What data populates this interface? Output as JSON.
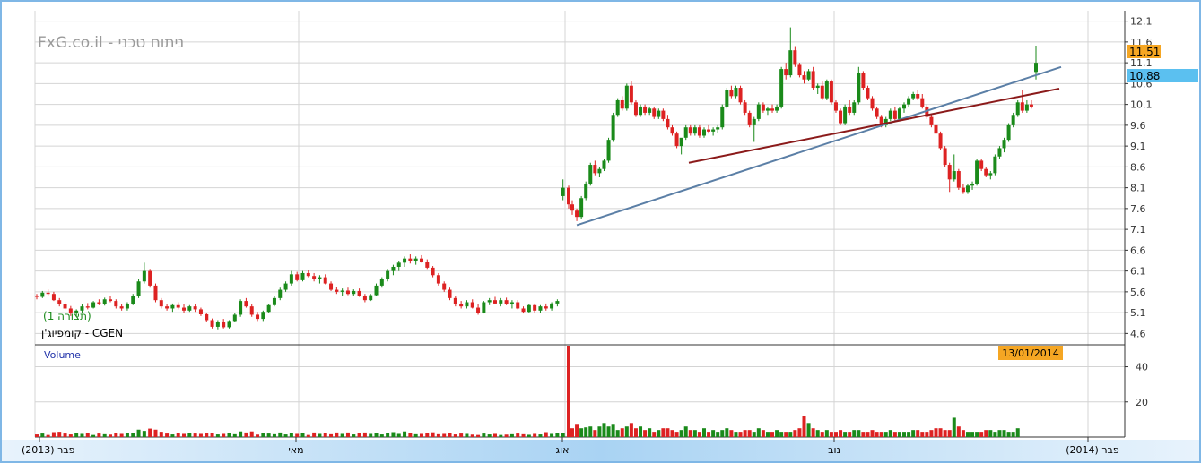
{
  "watermark": "FxG.co.il - ניתוח טכני",
  "instrument": "קומפיוג'ן - CGEN",
  "view_label": "(תצורה 1)",
  "volume_label": "Volume",
  "date_badge": "13/01/2014",
  "colors": {
    "up": "#1a8a1a",
    "down": "#dd2222",
    "trend_blue": "#5b7fa6",
    "trend_red": "#8b1a1a",
    "last_price_badge": "#f5a623",
    "prev_price_badge": "#5bc0f0",
    "date_badge": "#f5a623",
    "frame": "#7fb7e6",
    "grid": "#d4d4d4"
  },
  "chart_data": {
    "type": "candlestick",
    "price_axis": {
      "ticks": [
        "12.1",
        "11.6",
        "11.1",
        "10.6",
        "10.1",
        "9.6",
        "9.1",
        "8.6",
        "8.1",
        "7.6",
        "7.1",
        "6.6",
        "6.1",
        "5.6",
        "5.1",
        "4.6"
      ],
      "range": [
        4.35,
        12.35
      ],
      "last_price": "11.51",
      "prev_price": "10.88"
    },
    "volume_axis": {
      "ticks": [
        "40",
        "20"
      ],
      "max": 52
    },
    "x_axis": {
      "labels": [
        "(2013) פבר",
        "מאי",
        "אוג",
        "נוב",
        "(2014) פבר"
      ]
    },
    "candles": [
      [
        5.5,
        5.55,
        5.42,
        5.48
      ],
      [
        5.48,
        5.62,
        5.45,
        5.58
      ],
      [
        5.58,
        5.66,
        5.5,
        5.55
      ],
      [
        5.55,
        5.6,
        5.38,
        5.4
      ],
      [
        5.4,
        5.45,
        5.25,
        5.3
      ],
      [
        5.3,
        5.36,
        5.16,
        5.2
      ],
      [
        5.2,
        5.26,
        5.02,
        5.08
      ],
      [
        5.08,
        5.18,
        5.0,
        5.15
      ],
      [
        5.15,
        5.3,
        5.1,
        5.25
      ],
      [
        5.25,
        5.33,
        5.18,
        5.22
      ],
      [
        5.22,
        5.38,
        5.2,
        5.35
      ],
      [
        5.35,
        5.42,
        5.28,
        5.3
      ],
      [
        5.3,
        5.46,
        5.27,
        5.42
      ],
      [
        5.42,
        5.5,
        5.35,
        5.38
      ],
      [
        5.38,
        5.42,
        5.2,
        5.25
      ],
      [
        5.25,
        5.3,
        5.15,
        5.2
      ],
      [
        5.2,
        5.35,
        5.15,
        5.3
      ],
      [
        5.3,
        5.55,
        5.28,
        5.5
      ],
      [
        5.5,
        5.9,
        5.45,
        5.85
      ],
      [
        5.85,
        6.3,
        5.8,
        6.1
      ],
      [
        6.1,
        6.15,
        5.7,
        5.75
      ],
      [
        5.75,
        5.8,
        5.35,
        5.4
      ],
      [
        5.4,
        5.45,
        5.2,
        5.25
      ],
      [
        5.25,
        5.3,
        5.15,
        5.2
      ],
      [
        5.2,
        5.32,
        5.12,
        5.28
      ],
      [
        5.28,
        5.35,
        5.18,
        5.22
      ],
      [
        5.22,
        5.3,
        5.1,
        5.15
      ],
      [
        5.15,
        5.28,
        5.12,
        5.25
      ],
      [
        5.25,
        5.3,
        5.12,
        5.18
      ],
      [
        5.18,
        5.22,
        5.02,
        5.06
      ],
      [
        5.06,
        5.1,
        4.88,
        4.92
      ],
      [
        4.92,
        4.96,
        4.72,
        4.76
      ],
      [
        4.76,
        4.92,
        4.7,
        4.88
      ],
      [
        4.88,
        4.95,
        4.72,
        4.75
      ],
      [
        4.75,
        4.92,
        4.72,
        4.9
      ],
      [
        4.9,
        5.1,
        4.88,
        5.05
      ],
      [
        5.05,
        5.42,
        5.0,
        5.38
      ],
      [
        5.38,
        5.45,
        5.22,
        5.25
      ],
      [
        5.25,
        5.3,
        5.0,
        5.05
      ],
      [
        5.05,
        5.12,
        4.9,
        4.95
      ],
      [
        4.95,
        5.15,
        4.9,
        5.12
      ],
      [
        5.12,
        5.3,
        5.1,
        5.28
      ],
      [
        5.28,
        5.5,
        5.25,
        5.45
      ],
      [
        5.45,
        5.7,
        5.4,
        5.65
      ],
      [
        5.65,
        5.85,
        5.6,
        5.8
      ],
      [
        5.8,
        6.1,
        5.75,
        6.02
      ],
      [
        6.02,
        6.08,
        5.85,
        5.88
      ],
      [
        5.88,
        6.1,
        5.85,
        6.05
      ],
      [
        6.05,
        6.12,
        5.95,
        5.98
      ],
      [
        5.98,
        6.05,
        5.85,
        5.9
      ],
      [
        5.9,
        6.0,
        5.8,
        5.95
      ],
      [
        5.95,
        6.02,
        5.78,
        5.8
      ],
      [
        5.8,
        5.85,
        5.62,
        5.65
      ],
      [
        5.65,
        5.72,
        5.55,
        5.6
      ],
      [
        5.6,
        5.68,
        5.5,
        5.63
      ],
      [
        5.63,
        5.7,
        5.52,
        5.55
      ],
      [
        5.55,
        5.66,
        5.5,
        5.62
      ],
      [
        5.62,
        5.68,
        5.48,
        5.5
      ],
      [
        5.5,
        5.55,
        5.35,
        5.4
      ],
      [
        5.4,
        5.55,
        5.38,
        5.52
      ],
      [
        5.52,
        5.8,
        5.5,
        5.75
      ],
      [
        5.75,
        5.95,
        5.7,
        5.9
      ],
      [
        5.9,
        6.15,
        5.85,
        6.1
      ],
      [
        6.1,
        6.25,
        6.0,
        6.2
      ],
      [
        6.2,
        6.35,
        6.1,
        6.3
      ],
      [
        6.3,
        6.45,
        6.2,
        6.4
      ],
      [
        6.4,
        6.5,
        6.28,
        6.35
      ],
      [
        6.35,
        6.45,
        6.25,
        6.4
      ],
      [
        6.4,
        6.48,
        6.3,
        6.32
      ],
      [
        6.32,
        6.38,
        6.15,
        6.18
      ],
      [
        6.18,
        6.22,
        5.95,
        6.0
      ],
      [
        6.0,
        6.05,
        5.75,
        5.8
      ],
      [
        5.8,
        5.85,
        5.6,
        5.65
      ],
      [
        5.65,
        5.7,
        5.4,
        5.45
      ],
      [
        5.45,
        5.5,
        5.25,
        5.3
      ],
      [
        5.3,
        5.38,
        5.2,
        5.25
      ],
      [
        5.25,
        5.4,
        5.2,
        5.35
      ],
      [
        5.35,
        5.42,
        5.2,
        5.22
      ],
      [
        5.22,
        5.3,
        5.05,
        5.1
      ],
      [
        5.1,
        5.38,
        5.08,
        5.35
      ],
      [
        5.35,
        5.45,
        5.28,
        5.4
      ],
      [
        5.4,
        5.48,
        5.3,
        5.32
      ],
      [
        5.32,
        5.45,
        5.25,
        5.4
      ],
      [
        5.4,
        5.46,
        5.28,
        5.3
      ],
      [
        5.3,
        5.4,
        5.2,
        5.35
      ],
      [
        5.35,
        5.4,
        5.18,
        5.2
      ],
      [
        5.2,
        5.25,
        5.08,
        5.12
      ],
      [
        5.12,
        5.3,
        5.1,
        5.28
      ],
      [
        5.28,
        5.32,
        5.1,
        5.15
      ],
      [
        5.15,
        5.28,
        5.1,
        5.25
      ],
      [
        5.25,
        5.32,
        5.15,
        5.2
      ],
      [
        5.2,
        5.35,
        5.15,
        5.32
      ],
      [
        5.32,
        5.42,
        5.25,
        5.38
      ],
      [
        7.9,
        8.3,
        7.8,
        8.1
      ],
      [
        8.1,
        8.15,
        7.6,
        7.7
      ],
      [
        7.7,
        7.8,
        7.45,
        7.55
      ],
      [
        7.55,
        7.6,
        7.3,
        7.4
      ],
      [
        7.4,
        7.9,
        7.35,
        7.85
      ],
      [
        7.85,
        8.25,
        7.8,
        8.2
      ],
      [
        8.2,
        8.7,
        8.15,
        8.65
      ],
      [
        8.65,
        8.75,
        8.4,
        8.45
      ],
      [
        8.45,
        8.6,
        8.35,
        8.55
      ],
      [
        8.55,
        8.8,
        8.5,
        8.75
      ],
      [
        8.75,
        9.3,
        8.7,
        9.25
      ],
      [
        9.25,
        9.9,
        9.2,
        9.85
      ],
      [
        9.85,
        10.25,
        9.8,
        10.2
      ],
      [
        10.2,
        10.3,
        9.95,
        10.0
      ],
      [
        10.0,
        10.6,
        9.95,
        10.55
      ],
      [
        10.55,
        10.65,
        10.1,
        10.15
      ],
      [
        10.15,
        10.2,
        9.8,
        9.85
      ],
      [
        9.85,
        10.1,
        9.8,
        10.05
      ],
      [
        10.05,
        10.1,
        9.85,
        9.9
      ],
      [
        9.9,
        10.05,
        9.85,
        10.0
      ],
      [
        10.0,
        10.05,
        9.75,
        9.8
      ],
      [
        9.8,
        10.0,
        9.75,
        9.95
      ],
      [
        9.95,
        10.0,
        9.7,
        9.75
      ],
      [
        9.75,
        9.85,
        9.5,
        9.55
      ],
      [
        9.55,
        9.6,
        9.35,
        9.4
      ],
      [
        9.4,
        9.45,
        9.05,
        9.1
      ],
      [
        9.1,
        9.15,
        8.9,
        9.3
      ],
      [
        9.3,
        9.6,
        9.25,
        9.55
      ],
      [
        9.55,
        9.6,
        9.35,
        9.4
      ],
      [
        9.4,
        9.6,
        9.35,
        9.55
      ],
      [
        9.55,
        9.6,
        9.3,
        9.35
      ],
      [
        9.35,
        9.55,
        9.3,
        9.5
      ],
      [
        9.5,
        9.6,
        9.4,
        9.45
      ],
      [
        9.45,
        9.55,
        9.35,
        9.5
      ],
      [
        9.5,
        9.6,
        9.42,
        9.55
      ],
      [
        9.55,
        10.1,
        9.5,
        10.05
      ],
      [
        10.05,
        10.5,
        10.0,
        10.45
      ],
      [
        10.45,
        10.55,
        10.25,
        10.3
      ],
      [
        10.3,
        10.55,
        10.25,
        10.5
      ],
      [
        10.5,
        10.55,
        10.1,
        10.15
      ],
      [
        10.15,
        10.2,
        9.85,
        9.9
      ],
      [
        9.9,
        9.95,
        9.55,
        9.6
      ],
      [
        9.6,
        9.8,
        9.2,
        9.75
      ],
      [
        9.75,
        10.15,
        9.7,
        10.1
      ],
      [
        10.1,
        10.15,
        9.9,
        9.95
      ],
      [
        9.95,
        10.05,
        9.85,
        10.0
      ],
      [
        10.0,
        10.1,
        9.9,
        9.95
      ],
      [
        9.95,
        10.1,
        9.9,
        10.05
      ],
      [
        10.05,
        11.0,
        10.0,
        10.95
      ],
      [
        10.95,
        11.1,
        10.7,
        10.8
      ],
      [
        10.8,
        11.95,
        10.75,
        11.4
      ],
      [
        11.4,
        11.5,
        11.0,
        11.05
      ],
      [
        11.05,
        11.1,
        10.75,
        10.8
      ],
      [
        10.8,
        10.9,
        10.6,
        10.7
      ],
      [
        10.7,
        10.95,
        10.65,
        10.9
      ],
      [
        10.9,
        11.0,
        10.45,
        10.5
      ],
      [
        10.5,
        10.6,
        10.35,
        10.55
      ],
      [
        10.55,
        10.65,
        10.2,
        10.25
      ],
      [
        10.25,
        10.7,
        10.2,
        10.65
      ],
      [
        10.65,
        10.7,
        10.1,
        10.15
      ],
      [
        10.15,
        10.2,
        9.9,
        9.95
      ],
      [
        9.95,
        10.0,
        9.6,
        9.65
      ],
      [
        9.65,
        10.1,
        9.6,
        10.05
      ],
      [
        10.05,
        10.2,
        9.85,
        9.9
      ],
      [
        9.9,
        10.2,
        9.85,
        10.15
      ],
      [
        10.15,
        11.0,
        10.1,
        10.85
      ],
      [
        10.85,
        10.9,
        10.45,
        10.5
      ],
      [
        10.5,
        10.55,
        10.2,
        10.25
      ],
      [
        10.25,
        10.3,
        9.95,
        10.0
      ],
      [
        10.0,
        10.05,
        9.75,
        9.8
      ],
      [
        9.8,
        9.85,
        9.55,
        9.6
      ],
      [
        9.6,
        9.8,
        9.55,
        9.75
      ],
      [
        9.75,
        10.0,
        9.7,
        9.95
      ],
      [
        9.95,
        10.05,
        9.7,
        9.75
      ],
      [
        9.75,
        10.05,
        9.7,
        10.0
      ],
      [
        10.0,
        10.15,
        9.9,
        10.1
      ],
      [
        10.1,
        10.3,
        10.05,
        10.25
      ],
      [
        10.25,
        10.4,
        10.2,
        10.35
      ],
      [
        10.35,
        10.45,
        10.2,
        10.25
      ],
      [
        10.25,
        10.35,
        10.0,
        10.05
      ],
      [
        10.05,
        10.1,
        9.75,
        9.8
      ],
      [
        9.8,
        9.85,
        9.55,
        9.6
      ],
      [
        9.6,
        9.65,
        9.35,
        9.4
      ],
      [
        9.4,
        9.45,
        9.0,
        9.05
      ],
      [
        9.05,
        9.1,
        8.6,
        8.65
      ],
      [
        8.65,
        8.7,
        8.0,
        8.3
      ],
      [
        8.3,
        8.9,
        8.25,
        8.5
      ],
      [
        8.5,
        8.55,
        8.05,
        8.1
      ],
      [
        8.1,
        8.2,
        7.95,
        8.0
      ],
      [
        8.0,
        8.2,
        7.95,
        8.15
      ],
      [
        8.15,
        8.25,
        8.05,
        8.2
      ],
      [
        8.2,
        8.8,
        8.15,
        8.75
      ],
      [
        8.75,
        8.8,
        8.5,
        8.55
      ],
      [
        8.55,
        8.6,
        8.35,
        8.4
      ],
      [
        8.4,
        8.5,
        8.3,
        8.45
      ],
      [
        8.45,
        8.9,
        8.4,
        8.85
      ],
      [
        8.85,
        9.1,
        8.8,
        9.05
      ],
      [
        9.05,
        9.3,
        8.95,
        9.25
      ],
      [
        9.25,
        9.65,
        9.2,
        9.6
      ],
      [
        9.6,
        9.9,
        9.55,
        9.85
      ],
      [
        9.85,
        10.2,
        9.8,
        10.15
      ],
      [
        10.15,
        10.45,
        9.9,
        9.95
      ],
      [
        9.95,
        10.2,
        9.9,
        10.1
      ],
      [
        10.1,
        10.2,
        10.0,
        10.05
      ],
      [
        10.88,
        11.51,
        10.7,
        11.1
      ]
    ],
    "volume": [
      1.5,
      2,
      1.2,
      2.8,
      3,
      2,
      1.5,
      2.2,
      1.8,
      2.5,
      1.2,
      2,
      1.6,
      1.4,
      2.2,
      1.8,
      2.2,
      2.5,
      4.2,
      3.5,
      4.8,
      4.2,
      3,
      2,
      1.5,
      2.2,
      1.8,
      2.5,
      2,
      1.8,
      2.5,
      2.2,
      1.5,
      1.8,
      2.2,
      1.6,
      3.2,
      2.6,
      3.2,
      1.4,
      2.2,
      2,
      1.6,
      2.6,
      1.5,
      2.2,
      1.8,
      2.5,
      1.2,
      2.6,
      1.8,
      2.5,
      1.6,
      2.6,
      1.8,
      2.6,
      1.5,
      2.2,
      2.6,
      1.8,
      2.5,
      1.5,
      2.2,
      2.8,
      1.8,
      3.2,
      2.2,
      1.6,
      1.8,
      2.4,
      2.7,
      1.6,
      1.8,
      2.5,
      1.5,
      2,
      1.8,
      1.4,
      1.2,
      2,
      1.5,
      1.8,
      1.2,
      1.4,
      1.6,
      2,
      1.6,
      1.3,
      1.8,
      1.5,
      2.8,
      1.8,
      2.2,
      2.2,
      52,
      5,
      7,
      5,
      5.5,
      6,
      4,
      6,
      8,
      6,
      7,
      4,
      5,
      6,
      8,
      5,
      6,
      4,
      5,
      3,
      4,
      5,
      5,
      4,
      3,
      4,
      6,
      4,
      4,
      3,
      5,
      3,
      4,
      3,
      4,
      5,
      4,
      3,
      3,
      4,
      4,
      3,
      5,
      4,
      3,
      3,
      4,
      3,
      3,
      3,
      4,
      5,
      12,
      8,
      5,
      4,
      3,
      4,
      3,
      3,
      4,
      3,
      3,
      4,
      4,
      3,
      3,
      4,
      3,
      3,
      3,
      4,
      3,
      3,
      3,
      3,
      4,
      4,
      3,
      3,
      4,
      5,
      5,
      4,
      4,
      11,
      6,
      4,
      3,
      3,
      3,
      3,
      4,
      4,
      3,
      4,
      4,
      3,
      3,
      5
    ]
  }
}
